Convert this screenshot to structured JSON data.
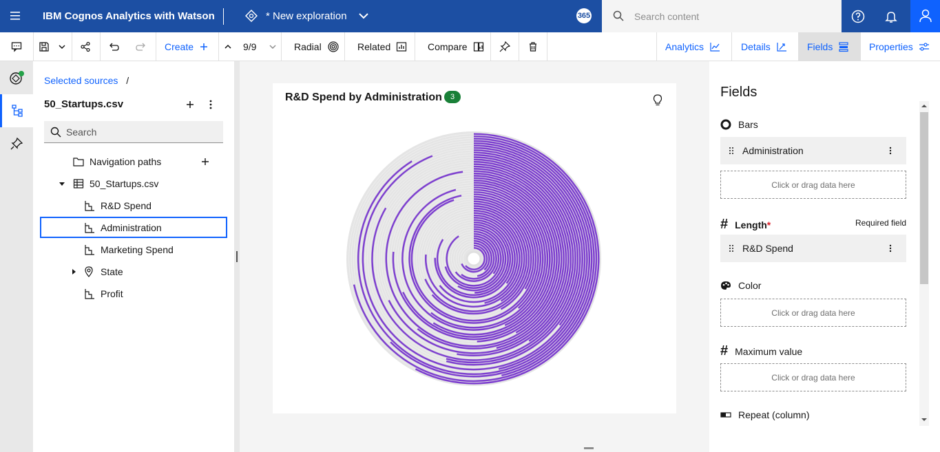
{
  "app": {
    "title": "IBM Cognos Analytics with Watson",
    "exploration_title": "* New exploration",
    "badge": "365"
  },
  "search": {
    "placeholder": "Search content"
  },
  "toolbar": {
    "create_label": "Create",
    "page_indicator": "9/9",
    "radial_label": "Radial",
    "related_label": "Related",
    "compare_label": "Compare",
    "analytics_label": "Analytics",
    "details_label": "Details",
    "fields_label": "Fields",
    "properties_label": "Properties"
  },
  "sources": {
    "breadcrumb": "Selected sources",
    "breadcrumb_sep": "/",
    "file": "50_Startups.csv",
    "search_placeholder": "Search",
    "tree": [
      {
        "label": "Navigation paths"
      },
      {
        "label": "50_Startups.csv"
      },
      {
        "label": "R&D Spend"
      },
      {
        "label": "Administration"
      },
      {
        "label": "Marketing Spend"
      },
      {
        "label": "State"
      },
      {
        "label": "Profit"
      }
    ]
  },
  "visualization": {
    "title": "R&D Spend by Administration",
    "count_badge": "3"
  },
  "fields": {
    "heading": "Fields",
    "bars_label": "Bars",
    "bars_field": "Administration",
    "drop_hint": "Click or drag data here",
    "length_label": "Length",
    "required_star": "*",
    "required_text": "Required field",
    "length_field": "R&D Spend",
    "color_label": "Color",
    "max_label": "Maximum value",
    "repeat_label": "Repeat (column)"
  },
  "colors": {
    "brand": "#1c4fa3",
    "accent": "#0f62fe",
    "bar": "#7d3fcf",
    "track": "#e0e0e0",
    "badge": "#198038"
  }
}
